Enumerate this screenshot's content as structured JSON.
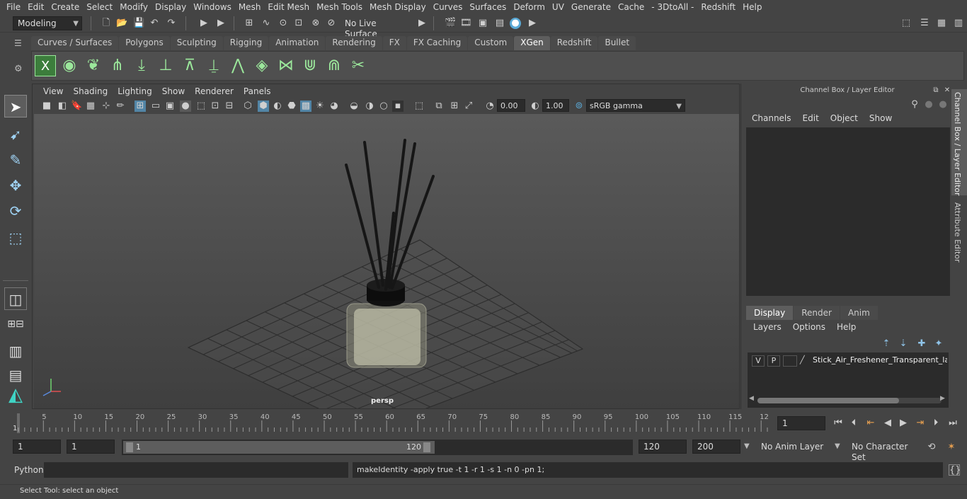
{
  "menubar": [
    "File",
    "Edit",
    "Create",
    "Select",
    "Modify",
    "Display",
    "Windows",
    "Mesh",
    "Edit Mesh",
    "Mesh Tools",
    "Mesh Display",
    "Curves",
    "Surfaces",
    "Deform",
    "UV",
    "Generate",
    "Cache",
    "- 3DtoAll -",
    "Redshift",
    "Help"
  ],
  "status": {
    "mode": "Modeling",
    "live_surface": "No Live Surface"
  },
  "shelf_tabs": [
    "Curves / Surfaces",
    "Polygons",
    "Sculpting",
    "Rigging",
    "Animation",
    "Rendering",
    "FX",
    "FX Caching",
    "Custom",
    "XGen",
    "Redshift",
    "Bullet"
  ],
  "active_shelf": "XGen",
  "viewport": {
    "menu": [
      "View",
      "Shading",
      "Lighting",
      "Show",
      "Renderer",
      "Panels"
    ],
    "exposure": "0.00",
    "gamma": "1.00",
    "colorspace": "sRGB gamma",
    "camera_label": "persp"
  },
  "channel_box": {
    "title": "Channel Box / Layer Editor",
    "menu": [
      "Channels",
      "Edit",
      "Object",
      "Show"
    ]
  },
  "layer_editor": {
    "tabs": [
      "Display",
      "Render",
      "Anim"
    ],
    "active_tab": "Display",
    "menu": [
      "Layers",
      "Options",
      "Help"
    ],
    "layers": [
      {
        "v": "V",
        "p": "P",
        "name": "Stick_Air_Freshener_Transparent_laye"
      }
    ]
  },
  "side_tabs": [
    "Channel Box / Layer Editor",
    "Attribute Editor"
  ],
  "timeline": {
    "ticks": [
      "5",
      "10",
      "15",
      "20",
      "25",
      "30",
      "35",
      "40",
      "45",
      "50",
      "55",
      "60",
      "65",
      "70",
      "75",
      "80",
      "85",
      "90",
      "95",
      "100",
      "105",
      "110",
      "115",
      "12"
    ],
    "start_label": "1",
    "current_frame": "1"
  },
  "range": {
    "start": "1",
    "start2": "1",
    "slider_start": "1",
    "slider_end": "120",
    "end": "120",
    "end2": "200",
    "anim_layer": "No Anim Layer",
    "char_set": "No Character Set"
  },
  "command": {
    "lang": "Python",
    "output": "makeIdentity -apply true -t 1 -r 1 -s 1 -n 0 -pn 1;"
  },
  "help_line": "Select Tool: select an object",
  "colors": {
    "bg": "#444444",
    "field": "#2b2b2b",
    "accent": "#5285a6"
  }
}
